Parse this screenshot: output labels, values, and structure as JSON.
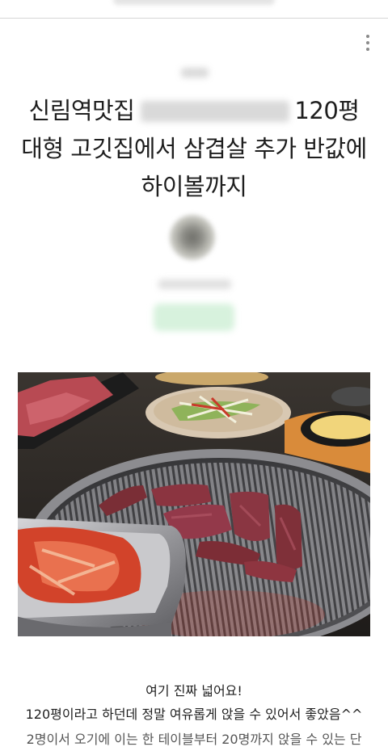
{
  "header": {
    "more_icon": "more-vertical-icon"
  },
  "post": {
    "title_lines": [
      "신림역맛집",
      "120평",
      "대형 고깃집에서 삼겹살 추가 반값에",
      "하이볼까지"
    ],
    "photo": {
      "description_icon": "grilled-beef-photo"
    },
    "body_lines": [
      "여기 진짜 넓어요!",
      "120평이라고 하던데 정말 여유롭게 앉을 수 있어서 좋았음^^",
      "2명이서 오기에 이는 한 테이블부터 20명까지 앉을 수 있는 단"
    ]
  },
  "colors": {
    "divider": "#d6d6d6",
    "text": "#1e1e1e",
    "follow_button": "#d7f2dd"
  }
}
